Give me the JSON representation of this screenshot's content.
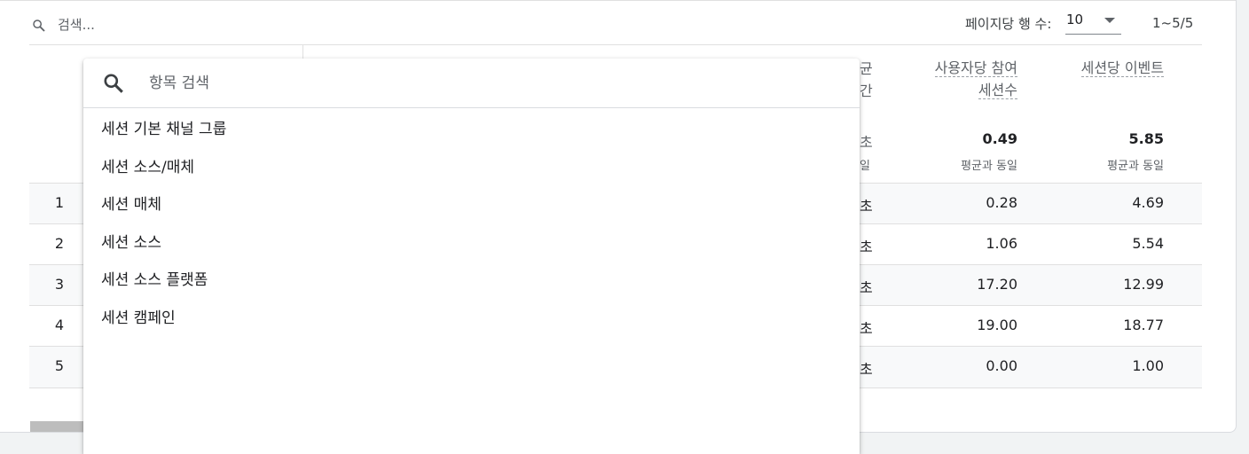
{
  "toolbar": {
    "search_placeholder": "검색...",
    "rows_per_page_label": "페이지당 행 수:",
    "rows_per_page_value": "10",
    "range": "1~5/5"
  },
  "table": {
    "partial_header": [
      "균",
      "간"
    ],
    "headers": {
      "engaged_sessions_per_user": [
        "사용자당 참여",
        "세션수"
      ],
      "events_per_session": "세션당 이벤트"
    },
    "totals": {
      "partial": "초",
      "partial_sub": "일",
      "engaged_sessions_per_user": "0.49",
      "engaged_sessions_per_user_sub": "평균과 동일",
      "events_per_session": "5.85",
      "events_per_session_sub": "평균과 동일"
    },
    "rows": [
      {
        "num": "1",
        "partial": "초",
        "engaged": "0.28",
        "events": "4.69"
      },
      {
        "num": "2",
        "partial": "초",
        "engaged": "1.06",
        "events": "5.54"
      },
      {
        "num": "3",
        "partial": "초",
        "engaged": "17.20",
        "events": "12.99"
      },
      {
        "num": "4",
        "partial": "초",
        "engaged": "19.00",
        "events": "18.77"
      },
      {
        "num": "5",
        "partial": "초",
        "engaged": "0.00",
        "events": "1.00"
      }
    ]
  },
  "dropdown": {
    "search_placeholder": "항목 검색",
    "items": [
      "세션 기본 채널 그룹",
      "세션 소스/매체",
      "세션 매체",
      "세션 소스",
      "세션 소스 플랫폼",
      "세션 캠페인"
    ]
  }
}
